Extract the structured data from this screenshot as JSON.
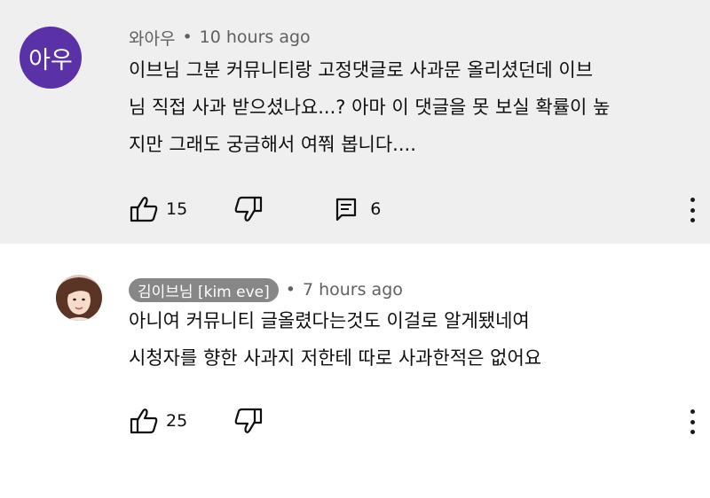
{
  "comments": [
    {
      "avatar_text": "아우",
      "avatar_color": "#5b31a8",
      "author": "와아우",
      "time": "10 hours ago",
      "lines": [
        "이브님 그분 커뮤니티랑 고정댓글로 사과문 올리셨던데 이브",
        "님 직접 사과 받으셨나요...? 아마 이 댓글을 못 보실 확률이 높",
        "지만 그래도 궁금해서 여쭤 봅니다...."
      ],
      "likes": "15",
      "replies": "6",
      "background": "#efefef"
    },
    {
      "author": "김이브님 [kim eve]",
      "author_badge_color": "#878787",
      "time": "7 hours ago",
      "lines": [
        "아니여 커뮤니티 글올렸다는것도 이걸로 알게됐네여",
        "시청자를 향한 사과지 저한테 따로 사과한적은 없어요"
      ],
      "likes": "25",
      "background": "#ffffff"
    }
  ],
  "icons": {
    "like": "thumb-up-icon",
    "dislike": "thumb-down-icon",
    "reply": "comment-icon",
    "more": "more-vert-icon"
  }
}
